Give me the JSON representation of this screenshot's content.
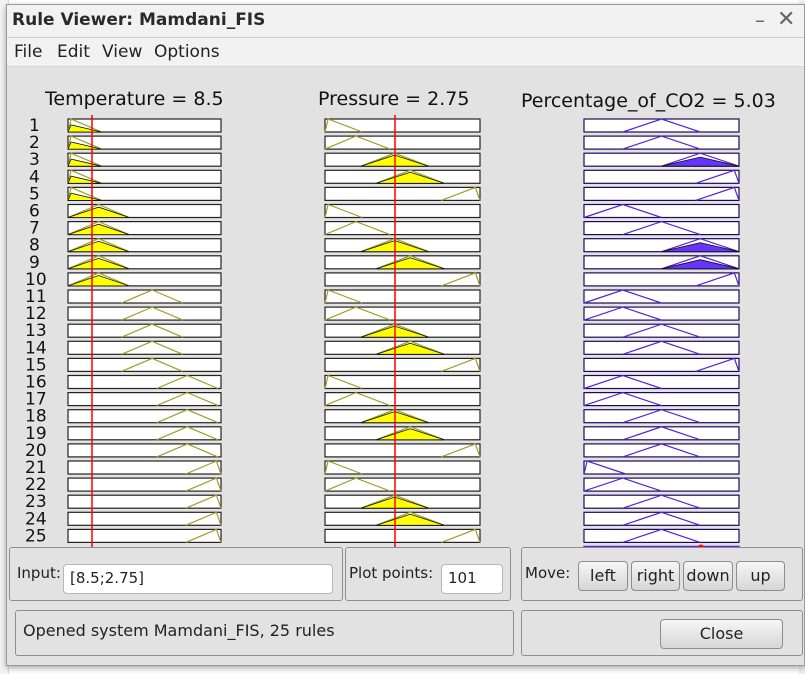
{
  "window": {
    "title": "Rule Viewer: Mamdani_FIS"
  },
  "menu": [
    "File",
    "Edit",
    "View",
    "Options"
  ],
  "plots": {
    "inputs": [
      {
        "name": "Temperature",
        "value": "8.5",
        "header": "Temperature = 8.5"
      },
      {
        "name": "Pressure",
        "value": "2.75",
        "header": "Pressure = 2.75"
      }
    ],
    "output": {
      "name": "Percentage_of_CO2",
      "value": "5.03",
      "header": "Percentage_of_CO2 = 5.03"
    },
    "rule_numbers": [
      "1",
      "2",
      "3",
      "4",
      "5",
      "6",
      "7",
      "8",
      "9",
      "10",
      "11",
      "12",
      "13",
      "14",
      "15",
      "16",
      "17",
      "18",
      "19",
      "20",
      "21",
      "22",
      "23",
      "24",
      "25"
    ],
    "colors": {
      "input_fill": "#ffff00",
      "input_line": "#9aa02a",
      "output_fill": "#6633ff",
      "output_line": "#5522dd",
      "marker": "#ff0000"
    }
  },
  "controls": {
    "input_label": "Input:",
    "input_value": "[8.5;2.75]",
    "plot_points_label": "Plot points:",
    "plot_points_value": "101",
    "move_label": "Move:",
    "move_buttons": {
      "left": "left",
      "right": "right",
      "down": "down",
      "up": "up"
    },
    "status": "Opened system Mamdani_FIS, 25 rules",
    "close_label": "Close"
  }
}
